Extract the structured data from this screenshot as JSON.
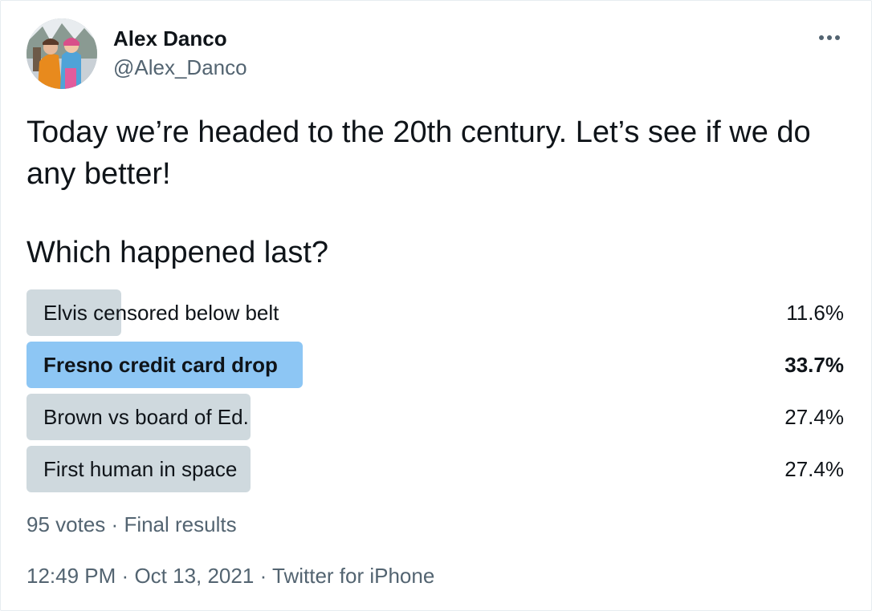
{
  "author": {
    "display_name": "Alex Danco",
    "handle": "@Alex_Danco"
  },
  "menu": {
    "icon": "more-horizontal-icon"
  },
  "tweet": {
    "line1": "Today we’re headed to the 20th century. Let’s see if we do any better!",
    "question": "Which happened last?"
  },
  "poll": {
    "options": [
      {
        "label": "Elvis censored below belt",
        "percent_text": "11.6%",
        "percent": 11.6,
        "winner": false
      },
      {
        "label": "Fresno credit card drop",
        "percent_text": "33.7%",
        "percent": 33.7,
        "winner": true
      },
      {
        "label": "Brown vs board of Ed.",
        "percent_text": "27.4%",
        "percent": 27.4,
        "winner": false
      },
      {
        "label": "First human in space",
        "percent_text": "27.4%",
        "percent": 27.4,
        "winner": false
      }
    ],
    "votes": "95 votes",
    "separator": "·",
    "status": "Final results"
  },
  "meta": {
    "time": "12:49 PM",
    "date": "Oct 13, 2021",
    "source": "Twitter for iPhone",
    "separator": "·"
  },
  "colors": {
    "winner_bar": "#8dc6f4",
    "other_bar": "#cfd9de",
    "secondary_text": "#536471"
  }
}
